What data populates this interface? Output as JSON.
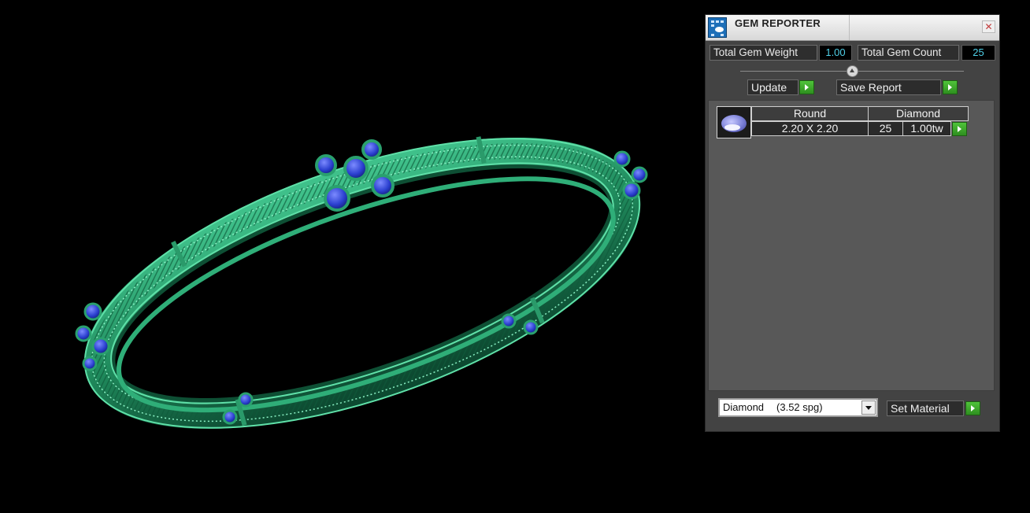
{
  "panel": {
    "title": "GEM REPORTER",
    "close_glyph": "✕",
    "total_gem_weight_label": "Total Gem Weight",
    "total_gem_weight_value": "1.00",
    "total_gem_count_label": "Total Gem Count",
    "total_gem_count_value": "25",
    "update_label": "Update",
    "save_report_label": "Save Report",
    "gem_row": {
      "shape": "Round",
      "material": "Diamond",
      "size": "2.20 X 2.20",
      "count": "25",
      "weight": "1.00tw"
    },
    "material_select": {
      "name": "Diamond",
      "gravity": "(3.52 spg)"
    },
    "set_material_label": "Set Material"
  },
  "colors": {
    "bracelet": "#1f8a5c",
    "gem": "#2a3fcf",
    "accent_button": "#3aa62a",
    "value_text": "#4fd0e8"
  },
  "icons": [
    "gem-reporter-icon",
    "close-icon",
    "play-arrow-icon",
    "gem-thumbnail-icon",
    "chevron-down-icon"
  ]
}
